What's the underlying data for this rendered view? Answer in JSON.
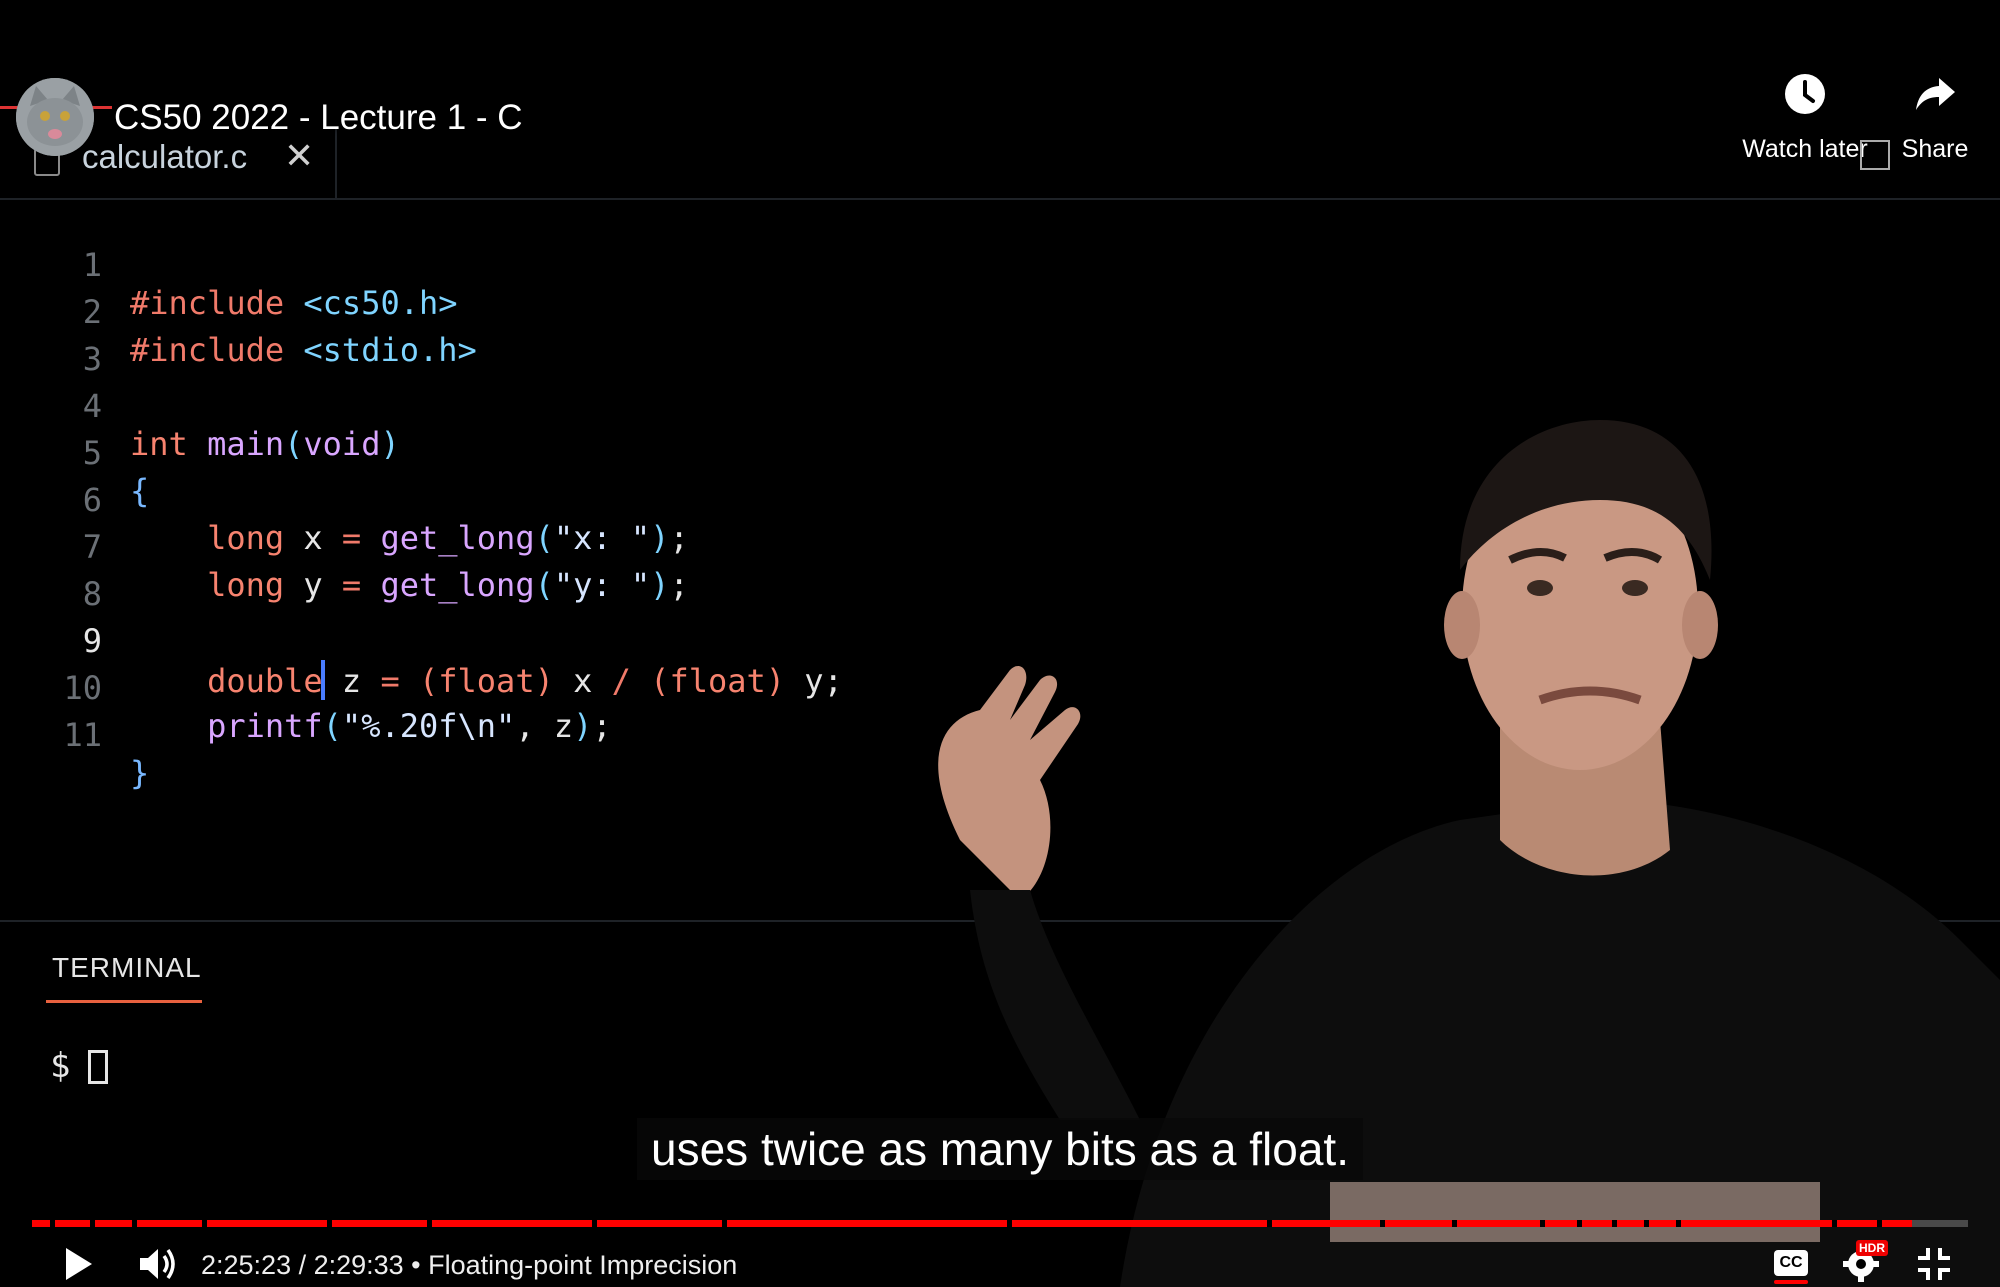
{
  "player": {
    "title": "CS50 2022 - Lecture 1 - C",
    "watch_later_label": "Watch later",
    "share_label": "Share",
    "caption": "uses twice as many bits as a float.",
    "time_display": "2:25:23 / 2:29:33 • Floating-point Imprecision",
    "progress_fraction": 0.971,
    "cc_label": "CC",
    "hdr_label": "HDR",
    "accent_color": "#ff0000"
  },
  "editor": {
    "tab_label": "calculator.c",
    "active_line": "9",
    "lines": [
      {
        "no": "1",
        "text": "#include <cs50.h>"
      },
      {
        "no": "2",
        "text": "#include <stdio.h>"
      },
      {
        "no": "3",
        "text": ""
      },
      {
        "no": "4",
        "text": "int main(void)"
      },
      {
        "no": "5",
        "text": "{"
      },
      {
        "no": "6",
        "text": "    long x = get_long(\"x: \");"
      },
      {
        "no": "7",
        "text": "    long y = get_long(\"y: \");"
      },
      {
        "no": "8",
        "text": ""
      },
      {
        "no": "9",
        "text": "    double z = (float) x / (float) y;"
      },
      {
        "no": "10",
        "text": "    printf(\"%.20f\\n\", z);"
      },
      {
        "no": "11",
        "text": "}"
      }
    ]
  },
  "terminal": {
    "tab_label": "TERMINAL",
    "prompt": "$"
  }
}
